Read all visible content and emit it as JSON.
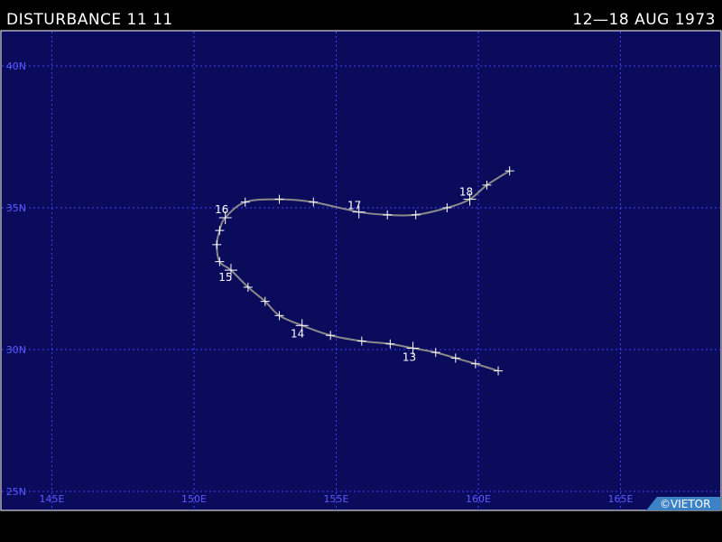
{
  "header": {
    "title": "DISTURBANCE 11 11",
    "dates": "12—18 AUG 1973"
  },
  "credit": "©VIETOR",
  "colors": {
    "background": "#000000",
    "ocean": "#0b0b5c",
    "grid": "#3f3fff",
    "track": "#8a8a8a",
    "marker": "#ffffff"
  },
  "map": {
    "lon_range": [
      143.5,
      168.5
    ],
    "lat_range": [
      25,
      41.5
    ],
    "lat_ticks": [
      {
        "value": 40,
        "label": "40N"
      },
      {
        "value": 35,
        "label": "35N"
      },
      {
        "value": 30,
        "label": "30N"
      },
      {
        "value": 25,
        "label": "25N"
      }
    ],
    "lon_ticks": [
      {
        "value": 145,
        "label": "145E"
      },
      {
        "value": 150,
        "label": "150E"
      },
      {
        "value": 155,
        "label": "155E"
      },
      {
        "value": 160,
        "label": "160E"
      },
      {
        "value": 165,
        "label": "165E"
      }
    ]
  },
  "track": [
    {
      "lon": 160.7,
      "lat": 29.25
    },
    {
      "lon": 159.9,
      "lat": 29.5
    },
    {
      "lon": 159.2,
      "lat": 29.7
    },
    {
      "lon": 158.5,
      "lat": 29.9
    },
    {
      "lon": 157.7,
      "lat": 30.05,
      "day": "13"
    },
    {
      "lon": 156.9,
      "lat": 30.2
    },
    {
      "lon": 155.9,
      "lat": 30.3
    },
    {
      "lon": 154.8,
      "lat": 30.5
    },
    {
      "lon": 153.8,
      "lat": 30.85,
      "day": "14"
    },
    {
      "lon": 153.0,
      "lat": 31.2
    },
    {
      "lon": 152.5,
      "lat": 31.7
    },
    {
      "lon": 151.9,
      "lat": 32.2
    },
    {
      "lon": 151.3,
      "lat": 32.8,
      "day": "15"
    },
    {
      "lon": 150.9,
      "lat": 33.1
    },
    {
      "lon": 150.8,
      "lat": 33.7
    },
    {
      "lon": 150.9,
      "lat": 34.2
    },
    {
      "lon": 151.1,
      "lat": 34.65,
      "day": "16"
    },
    {
      "lon": 151.8,
      "lat": 35.2
    },
    {
      "lon": 153.0,
      "lat": 35.3
    },
    {
      "lon": 154.2,
      "lat": 35.2
    },
    {
      "lon": 155.8,
      "lat": 34.85,
      "day": "17"
    },
    {
      "lon": 156.8,
      "lat": 34.75
    },
    {
      "lon": 157.8,
      "lat": 34.75
    },
    {
      "lon": 158.9,
      "lat": 35.0
    },
    {
      "lon": 159.7,
      "lat": 35.3,
      "day": "18"
    },
    {
      "lon": 160.3,
      "lat": 35.8
    },
    {
      "lon": 161.1,
      "lat": 36.3
    }
  ]
}
